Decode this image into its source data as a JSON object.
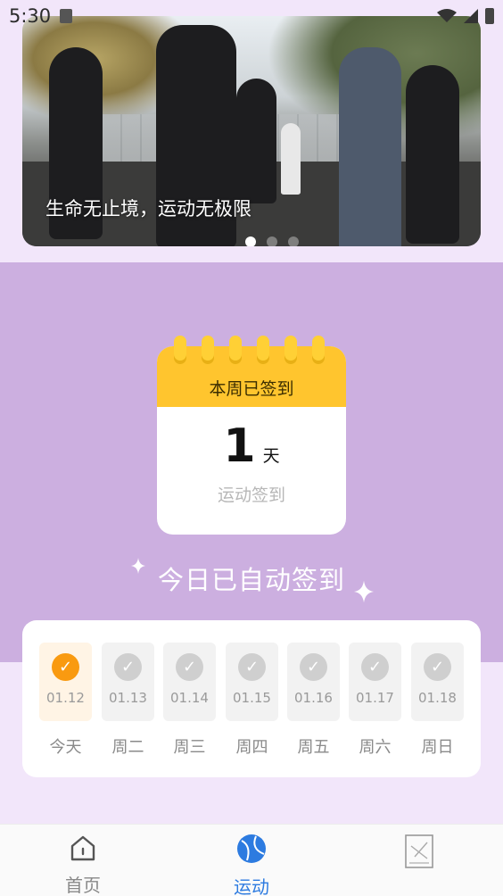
{
  "status_bar": {
    "time": "5:30"
  },
  "banner": {
    "caption": "生命无止境，运动无极限",
    "dots_count": 3,
    "active_dot": 1
  },
  "weekly_signin": {
    "header": "本周已签到",
    "count": "1",
    "unit": "天",
    "subtitle": "运动签到"
  },
  "auto_signed_text": "今日已自动签到",
  "week": [
    {
      "date": "01.12",
      "label": "今天",
      "today": true
    },
    {
      "date": "01.13",
      "label": "周二",
      "today": false
    },
    {
      "date": "01.14",
      "label": "周三",
      "today": false
    },
    {
      "date": "01.15",
      "label": "周四",
      "today": false
    },
    {
      "date": "01.16",
      "label": "周五",
      "today": false
    },
    {
      "date": "01.17",
      "label": "周六",
      "today": false
    },
    {
      "date": "01.18",
      "label": "周日",
      "today": false
    }
  ],
  "tabs": [
    {
      "label": "首页",
      "icon": "home-icon",
      "active": false
    },
    {
      "label": "运动",
      "icon": "ball-icon",
      "active": true
    },
    {
      "label": "",
      "icon": "chart-icon",
      "active": false
    }
  ],
  "colors": {
    "accent": "#2d7be0",
    "today_check": "#f99a10",
    "calendar_header": "#ffc52e",
    "purple_section": "#ccafe0",
    "page_bg": "#f2e6fa"
  }
}
